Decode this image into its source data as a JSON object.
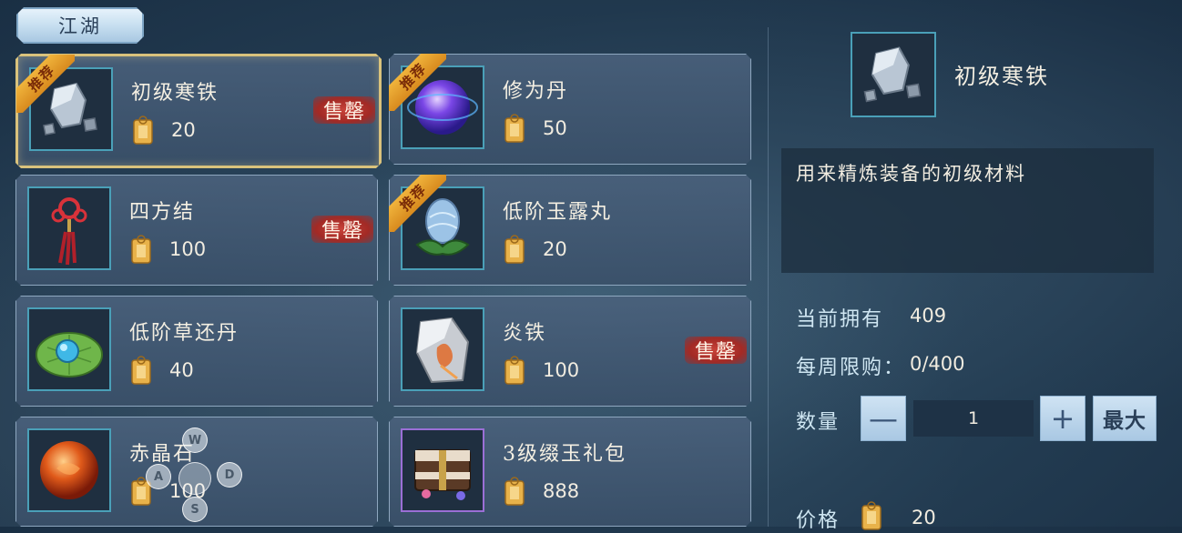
{
  "tabs": {
    "active_label": "江湖"
  },
  "recommend_label": "推荐",
  "soldout_label": "售罄",
  "items": [
    {
      "name": "初级寒铁",
      "price": "20",
      "icon": "iron-ore-icon",
      "recommended": true,
      "soldout": true,
      "selected": true
    },
    {
      "name": "修为丹",
      "price": "50",
      "icon": "purple-pill-icon",
      "recommended": true,
      "soldout": false,
      "selected": false
    },
    {
      "name": "四方结",
      "price": "100",
      "icon": "red-knot-icon",
      "recommended": false,
      "soldout": true,
      "selected": false
    },
    {
      "name": "低阶玉露丸",
      "price": "20",
      "icon": "jade-pill-icon",
      "recommended": true,
      "soldout": false,
      "selected": false
    },
    {
      "name": "低阶草还丹",
      "price": "40",
      "icon": "herb-pill-icon",
      "recommended": false,
      "soldout": false,
      "selected": false
    },
    {
      "name": "炎铁",
      "price": "100",
      "icon": "flame-iron-icon",
      "recommended": false,
      "soldout": true,
      "selected": false
    },
    {
      "name": "赤晶石",
      "price": "100",
      "icon": "red-crystal-icon",
      "recommended": false,
      "soldout": false,
      "selected": false
    },
    {
      "name": "3级缀玉礼包",
      "price": "888",
      "icon": "gift-chest-icon",
      "recommended": false,
      "soldout": false,
      "selected": false
    }
  ],
  "detail": {
    "title": "初级寒铁",
    "description": "用来精炼装备的初级材料",
    "owned_label": "当前拥有",
    "owned_value": "409",
    "weekly_label": "每周限购：",
    "weekly_value": "0/400",
    "quantity_label": "数量",
    "quantity_value": "1",
    "minus_label": "—",
    "plus_label": "+",
    "max_label": "最大",
    "price_label": "价格",
    "price_value": "20"
  },
  "dpad": {
    "up": "W",
    "left": "A",
    "right": "D",
    "down": "S"
  }
}
